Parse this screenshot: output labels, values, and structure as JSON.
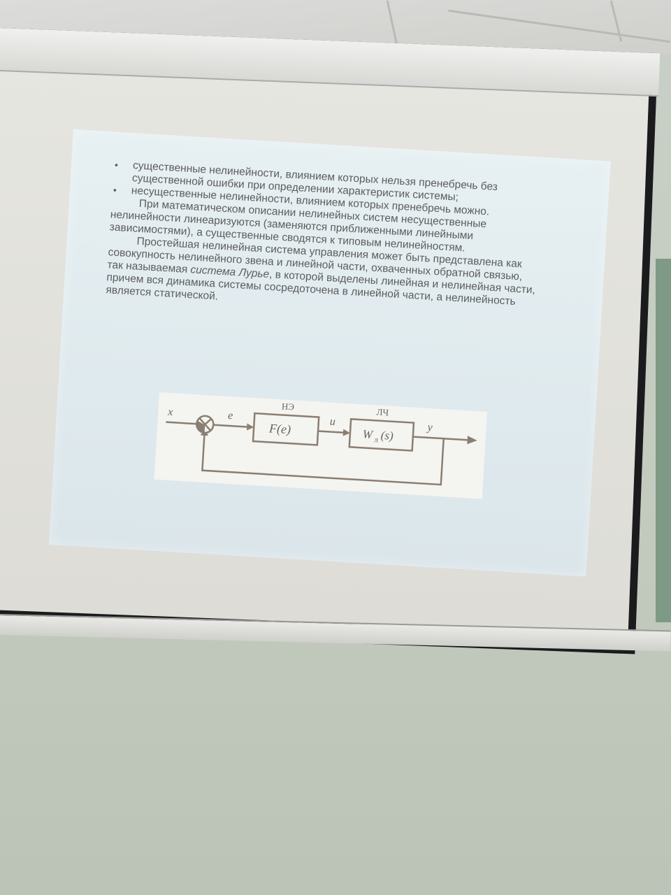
{
  "slide": {
    "bullet_1": "существенные нелинейности, влиянием которых нельзя пренебречь без существенной ошибки при определении характеристик системы;",
    "bullet_2": "несущественные нелинейности, влиянием которых пренебречь можно.",
    "paragraph_1": "При математическом описании нелинейных систем несущественные нелинейности линеаризуются (заменяются приближенными линейными зависимостями), а существенные сводятся к типовым нелинейностям.",
    "paragraph_2_start": "Простейшая нелинейная система управления может быть представлена как совокупность нелинейного звена и линейной части, охваченных обратной связью, так называемая ",
    "paragraph_2_italic": "система Лурье",
    "paragraph_2_end": ", в которой выделены линейная и нелинейная части, причем вся динамика системы сосредоточена в линейной части, а нелинейность является статической.",
    "bullet_glyph": "•"
  },
  "diagram": {
    "label_ne": "НЭ",
    "label_lch": "ЛЧ",
    "signal_x": "x",
    "signal_e": "e",
    "signal_u": "u",
    "signal_y": "y",
    "block_nonlinear": "F(e)",
    "block_linear_main": "W",
    "block_linear_sub": "л",
    "block_linear_arg": "(s)",
    "line_color": "#8a7e72"
  }
}
